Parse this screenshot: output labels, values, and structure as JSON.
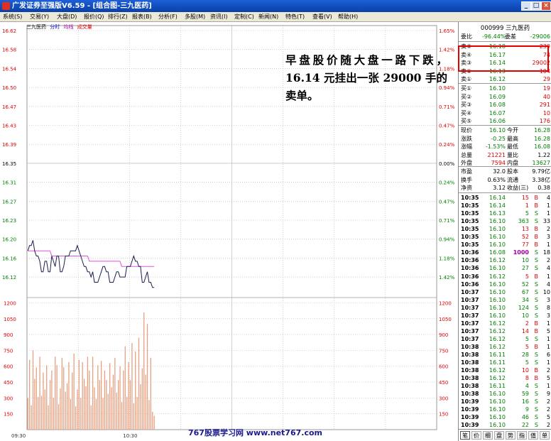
{
  "window": {
    "title": "广发证券至强版V6.59 - [组合图-三九医药]",
    "controls": [
      "_",
      "□",
      "×"
    ]
  },
  "menu": [
    "系统(S)",
    "交易(Y)",
    "大盘(D)",
    "报价(Q)",
    "排行(Z)",
    "报表(B)",
    "分析(F)",
    "多股(M)",
    "资讯(I)",
    "定制(C)",
    "新闻(N)",
    "特色(T)",
    "查看(V)",
    "帮助(H)"
  ],
  "legend": {
    "name": "三九医药",
    "items": [
      "分时",
      "均线",
      "成交量"
    ]
  },
  "price_axis": {
    "left": [
      "16.62",
      "16.58",
      "16.54",
      "16.50",
      "16.47",
      "16.43",
      "16.39",
      "16.35",
      "16.31",
      "16.27",
      "16.23",
      "16.20",
      "16.16",
      "16.12"
    ],
    "right": [
      "1.65%",
      "1.42%",
      "1.18%",
      "0.94%",
      "0.71%",
      "0.47%",
      "0.24%",
      "0.00%",
      "0.24%",
      "0.47%",
      "0.71%",
      "0.94%",
      "1.18%",
      "1.42%"
    ]
  },
  "volume_axis": [
    "1200",
    "1050",
    "900",
    "750",
    "600",
    "450",
    "300",
    "150"
  ],
  "time_axis": [
    "09:30",
    "10:30"
  ],
  "chart_data": {
    "type": "line",
    "price_range": [
      16.1,
      16.62
    ],
    "baseline": 16.35,
    "volume_range": [
      0,
      1250
    ],
    "total_minutes": 240,
    "price": [
      16.2,
      16.21,
      16.21,
      16.22,
      16.2,
      16.19,
      16.19,
      16.18,
      16.16,
      16.16,
      16.18,
      16.18,
      16.16,
      16.16,
      16.19,
      16.18,
      16.17,
      16.19,
      16.19,
      16.16,
      16.16,
      16.17,
      16.19,
      16.19,
      16.19,
      16.2,
      16.2,
      16.2,
      16.2,
      16.21,
      16.2,
      16.19,
      16.18,
      16.17,
      16.17,
      16.16,
      16.16,
      16.15,
      16.16,
      16.14,
      16.14,
      16.14,
      16.15,
      16.16,
      16.17,
      16.17,
      16.16,
      16.16,
      16.14,
      16.14,
      16.14,
      16.15,
      16.16,
      16.16,
      16.15,
      16.15,
      16.15,
      16.15,
      16.17,
      16.17,
      16.17,
      16.18,
      16.19,
      16.18,
      16.18,
      16.17,
      16.17,
      16.14,
      16.14,
      16.15,
      16.16,
      16.14,
      16.14,
      16.13,
      16.13
    ],
    "average": [
      16.2,
      16.2,
      16.2,
      16.2,
      16.2,
      16.2,
      16.2,
      16.2,
      16.2,
      16.2,
      16.2,
      16.2,
      16.2,
      16.2,
      16.19,
      16.19,
      16.19,
      16.19,
      16.19,
      16.19,
      16.19,
      16.19,
      16.19,
      16.19,
      16.19,
      16.19,
      16.19,
      16.19,
      16.19,
      16.19,
      16.19,
      16.19,
      16.19,
      16.19,
      16.19,
      16.19,
      16.18,
      16.18,
      16.18,
      16.18,
      16.18,
      16.18,
      16.18,
      16.18,
      16.18,
      16.18,
      16.18,
      16.18,
      16.18,
      16.18,
      16.18,
      16.18,
      16.18,
      16.18,
      16.18,
      16.17,
      16.17,
      16.17,
      16.17,
      16.17,
      16.17,
      16.17,
      16.17,
      16.17,
      16.17,
      16.17,
      16.17,
      16.17,
      16.17,
      16.17,
      16.17,
      16.17,
      16.17,
      16.17,
      16.17
    ],
    "volume": [
      300,
      660,
      230,
      750,
      480,
      590,
      310,
      690,
      320,
      540,
      380,
      610,
      230,
      470,
      560,
      300,
      690,
      610,
      240,
      390,
      680,
      590,
      360,
      440,
      640,
      290,
      540,
      720,
      220,
      380,
      660,
      300,
      640,
      480,
      410,
      690,
      560,
      230,
      690,
      400,
      290,
      610,
      470,
      650,
      300,
      560,
      470,
      340,
      630,
      400,
      520,
      680,
      350,
      470,
      600,
      260,
      560,
      790,
      310,
      640,
      470,
      820,
      250,
      740,
      310,
      870,
      430,
      580,
      1110,
      520,
      1000,
      280,
      680,
      170,
      130
    ]
  },
  "quote": {
    "code": "000999 三九医药",
    "wb_label": "委比",
    "wb_value": "-96.44%",
    "wc_label": "委差",
    "wc_value": "-29006",
    "sell": [
      {
        "label": "卖⑤",
        "price": "16.18",
        "vol": "239"
      },
      {
        "label": "卖④",
        "price": "16.17",
        "vol": "74"
      },
      {
        "label": "卖③",
        "price": "16.14",
        "vol": "29002"
      },
      {
        "label": "卖②",
        "price": "16.13",
        "vol": "104"
      },
      {
        "label": "卖①",
        "price": "16.12",
        "vol": "29"
      }
    ],
    "buy": [
      {
        "label": "买①",
        "price": "16.10",
        "vol": "19"
      },
      {
        "label": "买②",
        "price": "16.09",
        "vol": "40"
      },
      {
        "label": "买③",
        "price": "16.08",
        "vol": "291"
      },
      {
        "label": "买④",
        "price": "16.07",
        "vol": "10"
      },
      {
        "label": "买⑤",
        "price": "16.06",
        "vol": "176"
      }
    ],
    "stats": [
      {
        "l1": "现价",
        "v1": "16.10",
        "l2": "今开",
        "v2": "16.28"
      },
      {
        "l1": "涨跌",
        "v1": "-0.25",
        "l2": "最高",
        "v2": "16.28"
      },
      {
        "l1": "涨幅",
        "v1": "-1.53%",
        "l2": "最低",
        "v2": "16.08"
      },
      {
        "l1": "总量",
        "v1": "21221",
        "l2": "量比",
        "v2": "1.22"
      },
      {
        "l1": "外盘",
        "v1": "7594",
        "l2": "内盘",
        "v2": "13627"
      }
    ],
    "stats2": [
      {
        "l1": "市盈",
        "v1": "32.0",
        "l2": "股本",
        "v2": "9.79亿"
      },
      {
        "l1": "换手",
        "v1": "0.63%",
        "l2": "流通",
        "v2": "3.38亿"
      },
      {
        "l1": "净资",
        "v1": "3.12",
        "l2": "收益(三)",
        "v2": "0.38"
      }
    ]
  },
  "ticks": [
    [
      "10:35",
      "16.14",
      "15",
      "B",
      "4"
    ],
    [
      "10:35",
      "16.14",
      "1",
      "B",
      "1"
    ],
    [
      "10:35",
      "16.13",
      "5",
      "S",
      "1"
    ],
    [
      "10:35",
      "16.10",
      "363",
      "S",
      "33"
    ],
    [
      "10:35",
      "16.10",
      "13",
      "B",
      "2"
    ],
    [
      "10:35",
      "16.10",
      "52",
      "B",
      "3"
    ],
    [
      "10:35",
      "16.10",
      "77",
      "B",
      "1"
    ],
    [
      "10:36",
      "16.08",
      "1000",
      "S",
      "18"
    ],
    [
      "10:36",
      "16.12",
      "10",
      "S",
      "2"
    ],
    [
      "10:36",
      "16.10",
      "27",
      "S",
      "4"
    ],
    [
      "10:36",
      "16.12",
      "5",
      "B",
      "1"
    ],
    [
      "10:36",
      "16.10",
      "52",
      "S",
      "4"
    ],
    [
      "10:37",
      "16.10",
      "67",
      "S",
      "10"
    ],
    [
      "10:37",
      "16.10",
      "34",
      "S",
      "3"
    ],
    [
      "10:37",
      "16.10",
      "124",
      "S",
      "8"
    ],
    [
      "10:37",
      "16.10",
      "10",
      "S",
      "3"
    ],
    [
      "10:37",
      "16.12",
      "2",
      "B",
      "1"
    ],
    [
      "10:37",
      "16.12",
      "14",
      "B",
      "5"
    ],
    [
      "10:37",
      "16.12",
      "5",
      "S",
      "1"
    ],
    [
      "10:38",
      "16.12",
      "5",
      "B",
      "1"
    ],
    [
      "10:38",
      "16.11",
      "28",
      "S",
      "6"
    ],
    [
      "10:38",
      "16.11",
      "5",
      "S",
      "1"
    ],
    [
      "10:38",
      "16.12",
      "10",
      "B",
      "2"
    ],
    [
      "10:38",
      "16.12",
      "8",
      "B",
      "5"
    ],
    [
      "10:38",
      "16.11",
      "4",
      "S",
      "1"
    ],
    [
      "10:38",
      "16.10",
      "59",
      "S",
      "9"
    ],
    [
      "10:39",
      "16.10",
      "16",
      "S",
      "2"
    ],
    [
      "10:39",
      "16.10",
      "9",
      "S",
      "2"
    ],
    [
      "10:39",
      "16.10",
      "46",
      "S",
      "5"
    ],
    [
      "10:39",
      "16.10",
      "22",
      "S",
      "2"
    ]
  ],
  "tabs": [
    "笔",
    "价",
    "细",
    "盘",
    "势",
    "指",
    "值",
    "单"
  ],
  "annotation": "早盘股价随大盘一路下跌，16.14 元挂出一张 29000 手的卖单。",
  "watermark": "767股票学习网 www.net767.com",
  "colors": {
    "price_line": "#1c1c50",
    "avg_line": "#e050e0",
    "volume_bar": "#e8a080",
    "up": "#e00000",
    "down": "#008000",
    "grid": "#b0b0b0",
    "title_bar": "#0a3fa8"
  }
}
